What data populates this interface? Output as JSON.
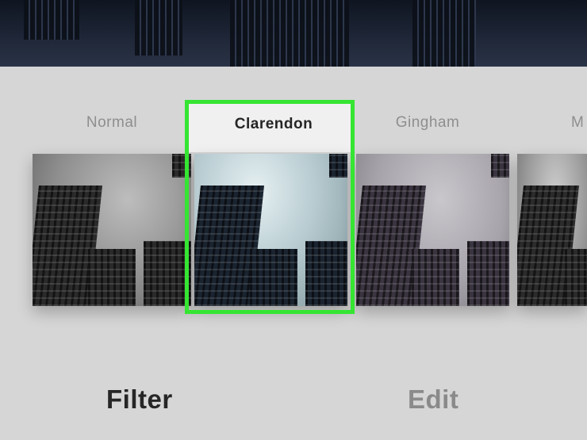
{
  "filters": [
    {
      "label": "Normal",
      "selected": false
    },
    {
      "label": "Clarendon",
      "selected": true
    },
    {
      "label": "Gingham",
      "selected": false
    },
    {
      "label": "M",
      "selected": false
    }
  ],
  "tabs": {
    "filter_label": "Filter",
    "edit_label": "Edit",
    "active": "Filter"
  },
  "colors": {
    "highlight": "#35e532",
    "background": "#d6d6d6",
    "active_text": "#262626",
    "inactive_text": "#8e8e8e"
  }
}
